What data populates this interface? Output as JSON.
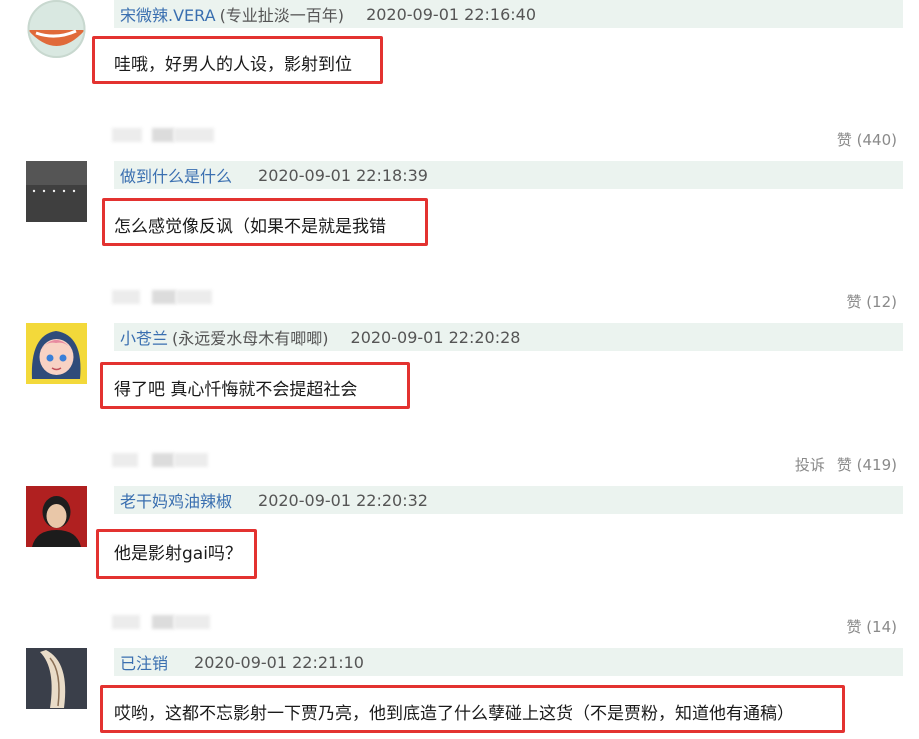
{
  "comments": [
    {
      "user": "宋微辣.VERA",
      "user_note": "(专业扯淡一百年)",
      "time": "2020-09-01 22:16:40",
      "text": "哇哦，好男人的人设，影射到位",
      "likes": "赞 (440)",
      "report": "",
      "avatar_icon": "cartoon-avatar-icon"
    },
    {
      "user": "做到什么是什么",
      "user_note": "",
      "time": "2020-09-01 22:18:39",
      "text": "怎么感觉像反讽（如果不是就是我错",
      "likes": "赞 (12)",
      "report": "",
      "avatar_icon": "dark-photo-avatar-icon"
    },
    {
      "user": "小苍兰",
      "user_note": "(永远爱水母木有唧唧)",
      "time": "2020-09-01 22:20:28",
      "text": "得了吧 真心忏悔就不会提超社会",
      "likes": "赞 (419)",
      "report": "投诉",
      "avatar_icon": "anime-girl-avatar-icon"
    },
    {
      "user": "老干妈鸡油辣椒",
      "user_note": "",
      "time": "2020-09-01 22:20:32",
      "text": "他是影射gai吗？",
      "likes": "赞 (14)",
      "report": "",
      "avatar_icon": "portrait-avatar-icon"
    },
    {
      "user": "已注销",
      "user_note": "",
      "time": "2020-09-01 22:21:10",
      "text": "哎哟，这都不忘影射一下贾乃亮，他到底造了什么孽碰上这货（不是贾粉，知道他有通稿）",
      "likes": "",
      "report": "",
      "avatar_icon": "feather-avatar-icon"
    }
  ],
  "colors": {
    "meta_bar": "#ebf3ef",
    "username": "#3a6fb0",
    "highlight_box": "#e33230",
    "action_text": "#8a8a8a"
  }
}
